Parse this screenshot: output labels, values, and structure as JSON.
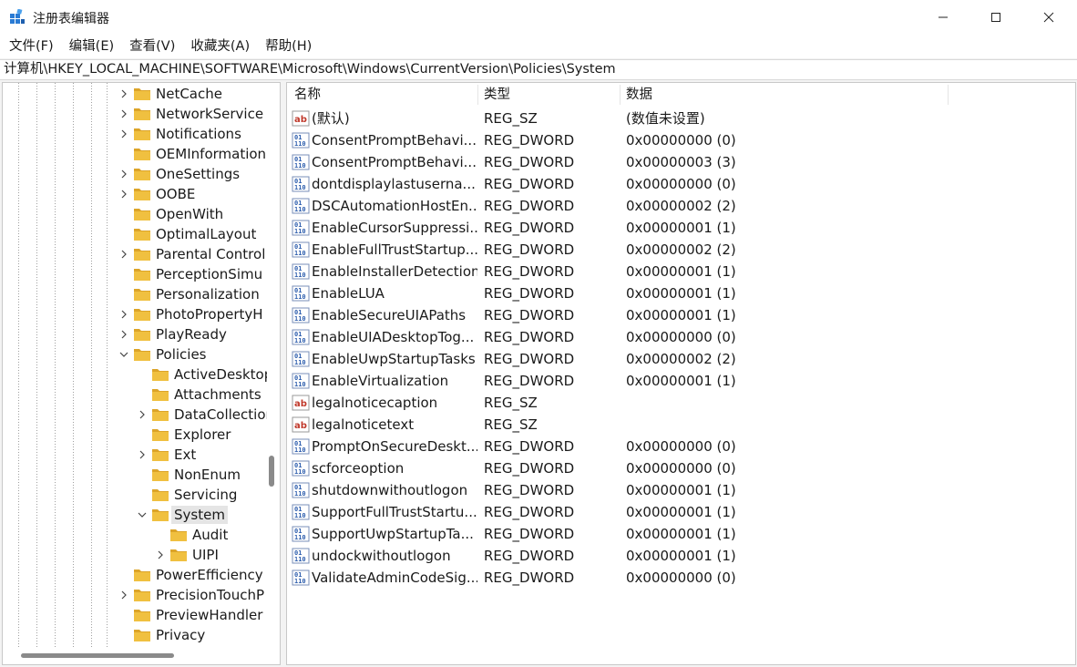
{
  "window": {
    "title": "注册表编辑器",
    "app_icon": "regedit-icon",
    "buttons": {
      "minimize": "minimize-icon",
      "maximize": "maximize-icon",
      "close": "close-icon"
    }
  },
  "menu": [
    "文件(F)",
    "编辑(E)",
    "查看(V)",
    "收藏夹(A)",
    "帮助(H)"
  ],
  "address": "计算机\\HKEY_LOCAL_MACHINE\\SOFTWARE\\Microsoft\\Windows\\CurrentVersion\\Policies\\System",
  "tree": [
    {
      "label": "NetCache",
      "level": 0,
      "expander": "collapsed"
    },
    {
      "label": "NetworkService",
      "level": 0,
      "expander": "collapsed"
    },
    {
      "label": "Notifications",
      "level": 0,
      "expander": "collapsed"
    },
    {
      "label": "OEMInformation",
      "level": 0,
      "expander": "none"
    },
    {
      "label": "OneSettings",
      "level": 0,
      "expander": "collapsed"
    },
    {
      "label": "OOBE",
      "level": 0,
      "expander": "collapsed"
    },
    {
      "label": "OpenWith",
      "level": 0,
      "expander": "none"
    },
    {
      "label": "OptimalLayout",
      "level": 0,
      "expander": "none"
    },
    {
      "label": "Parental Control",
      "level": 0,
      "expander": "collapsed"
    },
    {
      "label": "PerceptionSimu",
      "level": 0,
      "expander": "none"
    },
    {
      "label": "Personalization",
      "level": 0,
      "expander": "none"
    },
    {
      "label": "PhotoPropertyH",
      "level": 0,
      "expander": "collapsed"
    },
    {
      "label": "PlayReady",
      "level": 0,
      "expander": "collapsed"
    },
    {
      "label": "Policies",
      "level": 0,
      "expander": "expanded"
    },
    {
      "label": "ActiveDesktop",
      "level": 1,
      "expander": "none"
    },
    {
      "label": "Attachments",
      "level": 1,
      "expander": "none"
    },
    {
      "label": "DataCollection",
      "level": 1,
      "expander": "collapsed"
    },
    {
      "label": "Explorer",
      "level": 1,
      "expander": "none"
    },
    {
      "label": "Ext",
      "level": 1,
      "expander": "collapsed"
    },
    {
      "label": "NonEnum",
      "level": 1,
      "expander": "none"
    },
    {
      "label": "Servicing",
      "level": 1,
      "expander": "none"
    },
    {
      "label": "System",
      "level": 1,
      "expander": "expanded",
      "selected": true
    },
    {
      "label": "Audit",
      "level": 2,
      "expander": "none"
    },
    {
      "label": "UIPI",
      "level": 2,
      "expander": "collapsed"
    },
    {
      "label": "PowerEfficiency",
      "level": 0,
      "expander": "none"
    },
    {
      "label": "PrecisionTouchP",
      "level": 0,
      "expander": "collapsed"
    },
    {
      "label": "PreviewHandler",
      "level": 0,
      "expander": "none"
    },
    {
      "label": "Privacy",
      "level": 0,
      "expander": "none"
    }
  ],
  "columns": {
    "name": "名称",
    "type": "类型",
    "data": "数据"
  },
  "values": [
    {
      "name": "(默认)",
      "type": "REG_SZ",
      "data": "(数值未设置)",
      "icon": "string-value-icon"
    },
    {
      "name": "ConsentPromptBehavi...",
      "type": "REG_DWORD",
      "data": "0x00000000 (0)",
      "icon": "dword-value-icon"
    },
    {
      "name": "ConsentPromptBehavi...",
      "type": "REG_DWORD",
      "data": "0x00000003 (3)",
      "icon": "dword-value-icon"
    },
    {
      "name": "dontdisplaylastuserna...",
      "type": "REG_DWORD",
      "data": "0x00000000 (0)",
      "icon": "dword-value-icon"
    },
    {
      "name": "DSCAutomationHostEn...",
      "type": "REG_DWORD",
      "data": "0x00000002 (2)",
      "icon": "dword-value-icon"
    },
    {
      "name": "EnableCursorSuppressi...",
      "type": "REG_DWORD",
      "data": "0x00000001 (1)",
      "icon": "dword-value-icon"
    },
    {
      "name": "EnableFullTrustStartup...",
      "type": "REG_DWORD",
      "data": "0x00000002 (2)",
      "icon": "dword-value-icon"
    },
    {
      "name": "EnableInstallerDetection",
      "type": "REG_DWORD",
      "data": "0x00000001 (1)",
      "icon": "dword-value-icon"
    },
    {
      "name": "EnableLUA",
      "type": "REG_DWORD",
      "data": "0x00000001 (1)",
      "icon": "dword-value-icon"
    },
    {
      "name": "EnableSecureUIAPaths",
      "type": "REG_DWORD",
      "data": "0x00000001 (1)",
      "icon": "dword-value-icon"
    },
    {
      "name": "EnableUIADesktopTog...",
      "type": "REG_DWORD",
      "data": "0x00000000 (0)",
      "icon": "dword-value-icon"
    },
    {
      "name": "EnableUwpStartupTasks",
      "type": "REG_DWORD",
      "data": "0x00000002 (2)",
      "icon": "dword-value-icon"
    },
    {
      "name": "EnableVirtualization",
      "type": "REG_DWORD",
      "data": "0x00000001 (1)",
      "icon": "dword-value-icon"
    },
    {
      "name": "legalnoticecaption",
      "type": "REG_SZ",
      "data": "",
      "icon": "string-value-icon"
    },
    {
      "name": "legalnoticetext",
      "type": "REG_SZ",
      "data": "",
      "icon": "string-value-icon"
    },
    {
      "name": "PromptOnSecureDeskt...",
      "type": "REG_DWORD",
      "data": "0x00000000 (0)",
      "icon": "dword-value-icon"
    },
    {
      "name": "scforceoption",
      "type": "REG_DWORD",
      "data": "0x00000000 (0)",
      "icon": "dword-value-icon"
    },
    {
      "name": "shutdownwithoutlogon",
      "type": "REG_DWORD",
      "data": "0x00000001 (1)",
      "icon": "dword-value-icon"
    },
    {
      "name": "SupportFullTrustStartu...",
      "type": "REG_DWORD",
      "data": "0x00000001 (1)",
      "icon": "dword-value-icon"
    },
    {
      "name": "SupportUwpStartupTa...",
      "type": "REG_DWORD",
      "data": "0x00000001 (1)",
      "icon": "dword-value-icon"
    },
    {
      "name": "undockwithoutlogon",
      "type": "REG_DWORD",
      "data": "0x00000001 (1)",
      "icon": "dword-value-icon"
    },
    {
      "name": "ValidateAdminCodeSig...",
      "type": "REG_DWORD",
      "data": "0x00000000 (0)",
      "icon": "dword-value-icon"
    }
  ],
  "colors": {
    "folder": "#f0c040",
    "folder_dark": "#dca428",
    "selection": "#e5e5e5",
    "string_icon": "#c0392b",
    "dword_icon": "#2f5fae"
  }
}
